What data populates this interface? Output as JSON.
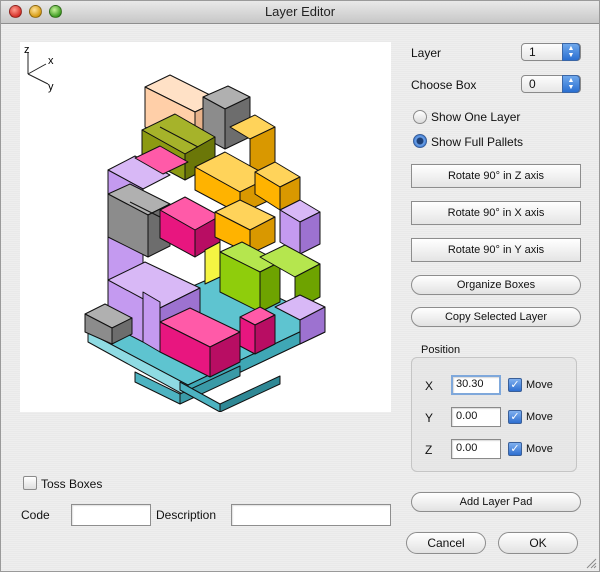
{
  "window": {
    "title": "Layer Editor"
  },
  "axes": {
    "z": "z",
    "x": "x",
    "y": "y"
  },
  "layer": {
    "label": "Layer",
    "value": "1"
  },
  "choose_box": {
    "label": "Choose Box",
    "value": "0"
  },
  "view_mode": {
    "show_one_layer": "Show One Layer",
    "show_full_pallets": "Show Full Pallets",
    "selected": "Show Full Pallets"
  },
  "buttons": {
    "rotate_z": "Rotate 90° in Z axis",
    "rotate_x": "Rotate 90° in X axis",
    "rotate_y": "Rotate 90° in Y axis",
    "organize": "Organize Boxes",
    "copy_layer": "Copy Selected Layer",
    "add_layer_pad": "Add Layer Pad",
    "cancel": "Cancel",
    "ok": "OK"
  },
  "position": {
    "title": "Position",
    "x_label": "X",
    "x_value": "30.30",
    "y_label": "Y",
    "y_value": "0.00",
    "z_label": "Z",
    "z_value": "0.00",
    "move_label": "Move",
    "x_move": true,
    "y_move": true,
    "z_move": true
  },
  "toss_boxes": {
    "label": "Toss Boxes",
    "checked": false
  },
  "code": {
    "label": "Code",
    "value": ""
  },
  "description": {
    "label": "Description",
    "value": ""
  },
  "colors": {
    "pink": "#e8167f",
    "lavender": "#c49af0",
    "orange": "#ffb300",
    "olive": "#8c9a12",
    "green": "#8fcd0c",
    "gray": "#8c8c8c",
    "peach": "#ffcfa8",
    "teal": "#5ec4d0",
    "yellow": "#f5f542"
  }
}
